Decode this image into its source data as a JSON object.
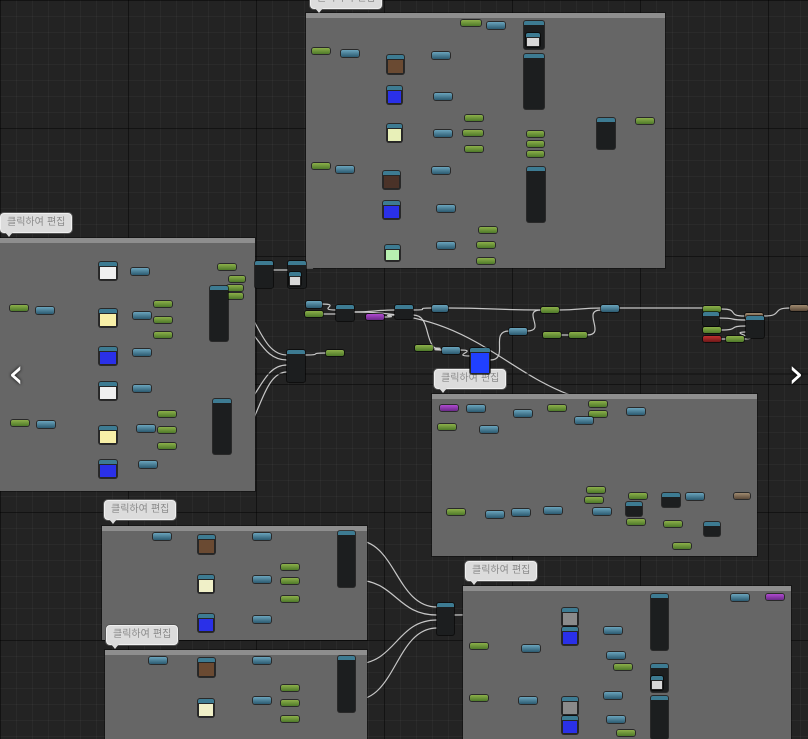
{
  "comment_label": "클릭하여 편집",
  "navigation": {
    "prev_glyph": "‹",
    "next_glyph": "›"
  },
  "icons": [
    "chevron-left-icon",
    "chevron-right-icon"
  ],
  "colors": {
    "background": "#232323",
    "comment_box": "#666666",
    "comment_header": "#8e8e8e",
    "node_header_blue": "#3d7b92",
    "pin_green": "#6c9a3a",
    "pin_purple": "#9a3ab8",
    "wire": "#d8d8d8"
  }
}
